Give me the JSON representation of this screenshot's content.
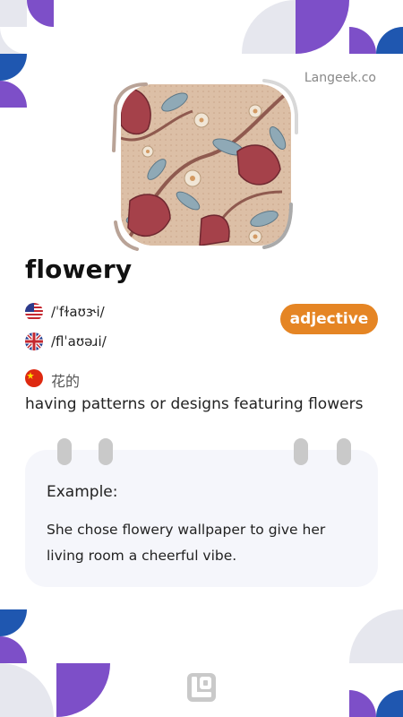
{
  "site": {
    "name": "Langeek.co"
  },
  "card": {
    "image_alt": "flowery wallpaper illustration",
    "word": "flowery",
    "pronunciations": [
      {
        "flag": "us-flag-icon",
        "ipa": "/ˈfɫaʊɝi/"
      },
      {
        "flag": "uk-flag-icon",
        "ipa": "/flˈaʊəɹi/"
      }
    ],
    "translation": {
      "flag": "china-flag-icon",
      "text": "花的"
    },
    "part_of_speech": "adjective",
    "definition": "having patterns or designs featuring flowers",
    "example": {
      "label": "Example:",
      "text": "She chose flowery wallpaper to give her living room a cheerful vibe."
    }
  },
  "colors": {
    "purple": "#7d4fc8",
    "blue": "#1f57b0",
    "light_gray": "#e6e7ee",
    "badge_orange": "#e58524",
    "card_bg": "#f5f6fb"
  },
  "footer": {
    "logo": "langeek-logo-icon"
  }
}
